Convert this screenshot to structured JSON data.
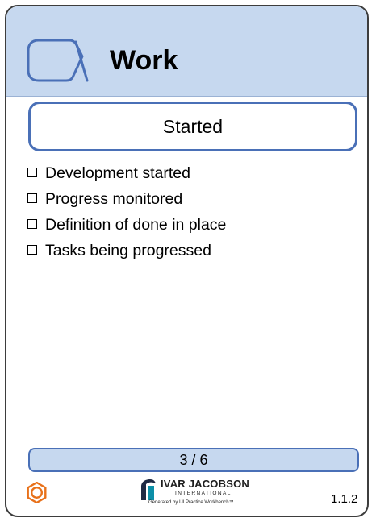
{
  "card": {
    "title": "Work",
    "state": "Started",
    "checklist": [
      "Development started",
      "Progress monitored",
      "Definition of done in place",
      "Tasks being progressed"
    ],
    "progress": "3 / 6",
    "version": "1.1.2"
  },
  "footer": {
    "logo_name": "IVAR JACOBSON",
    "logo_subtitle": "INTERNATIONAL",
    "generated_by": "Generated by IJI Practice Workbench™"
  },
  "icons": {
    "alpha": "alpha-icon",
    "settings": "gear-icon",
    "logo": "ivar-jacobson-logo-icon"
  },
  "colors": {
    "header_background": "#c6d8ef",
    "accent_border": "#4a70b7",
    "gear": "#e8711a",
    "logo_dark": "#1f2a44",
    "logo_teal": "#0c8fa8"
  }
}
